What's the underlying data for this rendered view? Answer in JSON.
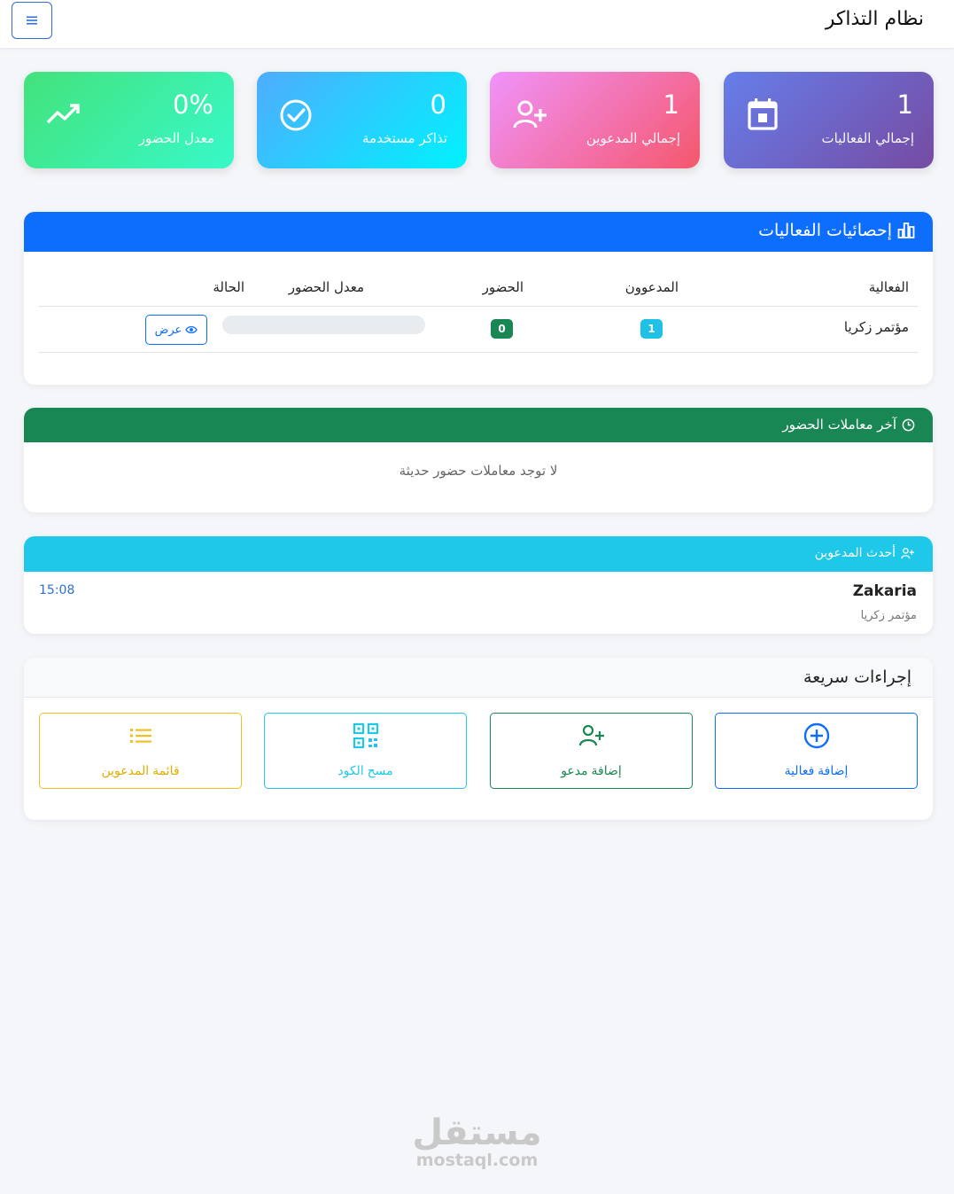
{
  "app": {
    "title": "نظام التذاكر"
  },
  "stats": [
    {
      "value": "1",
      "label": "إجمالي الفعاليات",
      "icon": "calendar-icon"
    },
    {
      "value": "1",
      "label": "إجمالي المدعوين",
      "icon": "user-plus-icon"
    },
    {
      "value": "0",
      "label": "تذاكر مستخدمة",
      "icon": "check-circle-icon"
    },
    {
      "value": "0%",
      "label": "معدل الحضور",
      "icon": "trending-up-icon"
    }
  ],
  "events_stats": {
    "title": "إحصائيات الفعاليات",
    "columns": [
      "الفعالية",
      "المدعوون",
      "الحضور",
      "معدل الحضور",
      "الحالة"
    ],
    "rows": [
      {
        "event": "مؤتمر زكريا",
        "invitees": "1",
        "attendance": "0",
        "rate_fraction": 0,
        "action": "عرض"
      }
    ]
  },
  "attendance": {
    "title": "آخر معاملات الحضور",
    "empty": "لا توجد معاملات حضور حديثة"
  },
  "latest_invitees": {
    "title": "أحدث المدعوين",
    "items": [
      {
        "name": "Zakaria",
        "event": "مؤتمر زكريا",
        "time": "15:08"
      }
    ]
  },
  "quick_actions": {
    "title": "إجراءات سريعة",
    "buttons": [
      {
        "label": "إضافة فعالية",
        "icon": "plus-circle-icon"
      },
      {
        "label": "إضافة مدعو",
        "icon": "user-plus-icon"
      },
      {
        "label": "مسح الكود",
        "icon": "qr-code-icon"
      },
      {
        "label": "قائمة المدعوين",
        "icon": "list-icon"
      }
    ]
  },
  "watermark": {
    "arabic": "مستقل",
    "latin": "mostaql.com"
  },
  "colors": {
    "primary": "#0d6efd",
    "success": "#198754",
    "info": "#1fc8e8",
    "warning": "#f0c020",
    "background": "#f5f6f9"
  }
}
